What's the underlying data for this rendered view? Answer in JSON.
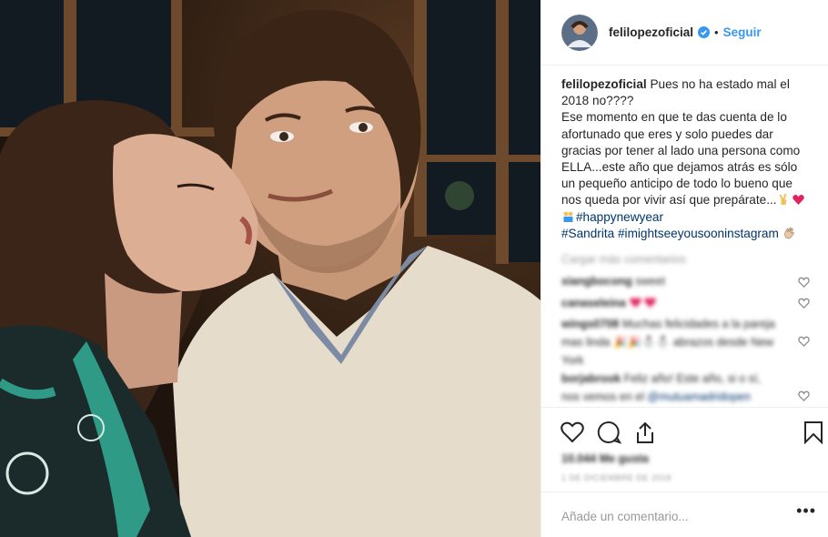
{
  "header": {
    "username": "felilopezoficial",
    "separator": "•",
    "follow_label": "Seguir"
  },
  "caption": {
    "username": "felilopezoficial",
    "line1": "Pues no ha estado mal el 2018 no????",
    "line2": "Ese momento en que te das cuenta de lo afortunado que eres y solo puedes dar gracias por tener al lado una persona como ELLA...este año que dejamos atrás es sólo un pequeño anticipo de todo lo bueno que nos queda por vivir así que prepárate...",
    "hashtag1": "#happynewyear",
    "hashtag2": "#Sandrita",
    "hashtag3": "#imightseeyousooninstagram"
  },
  "comments": {
    "load_more": "Cargar más comentarios",
    "items": [
      {
        "user": "xiangbocong",
        "text": "sweet"
      },
      {
        "user": "canaseleina",
        "text": ""
      },
      {
        "user": "wings0708",
        "text": "Muchas felicidades a la pareja mas linda 🎉🎉⛄⛄ abrazos desde New York"
      },
      {
        "user": "borjabrook",
        "text": "Feliz año! Este año, si o sí, nos vemos en el",
        "tag": "@mutuamadridopen"
      }
    ]
  },
  "actions": {
    "likes": "10.044 Me gusta",
    "date": "1 DE DICIEMBRE DE 2018"
  },
  "add_comment": {
    "placeholder": "Añade un comentario...",
    "more_label": "•••"
  },
  "colors": {
    "link": "#003569",
    "follow": "#3897f0",
    "verified": "#3897f0",
    "border": "#efefef",
    "heart": "#e0245e"
  }
}
